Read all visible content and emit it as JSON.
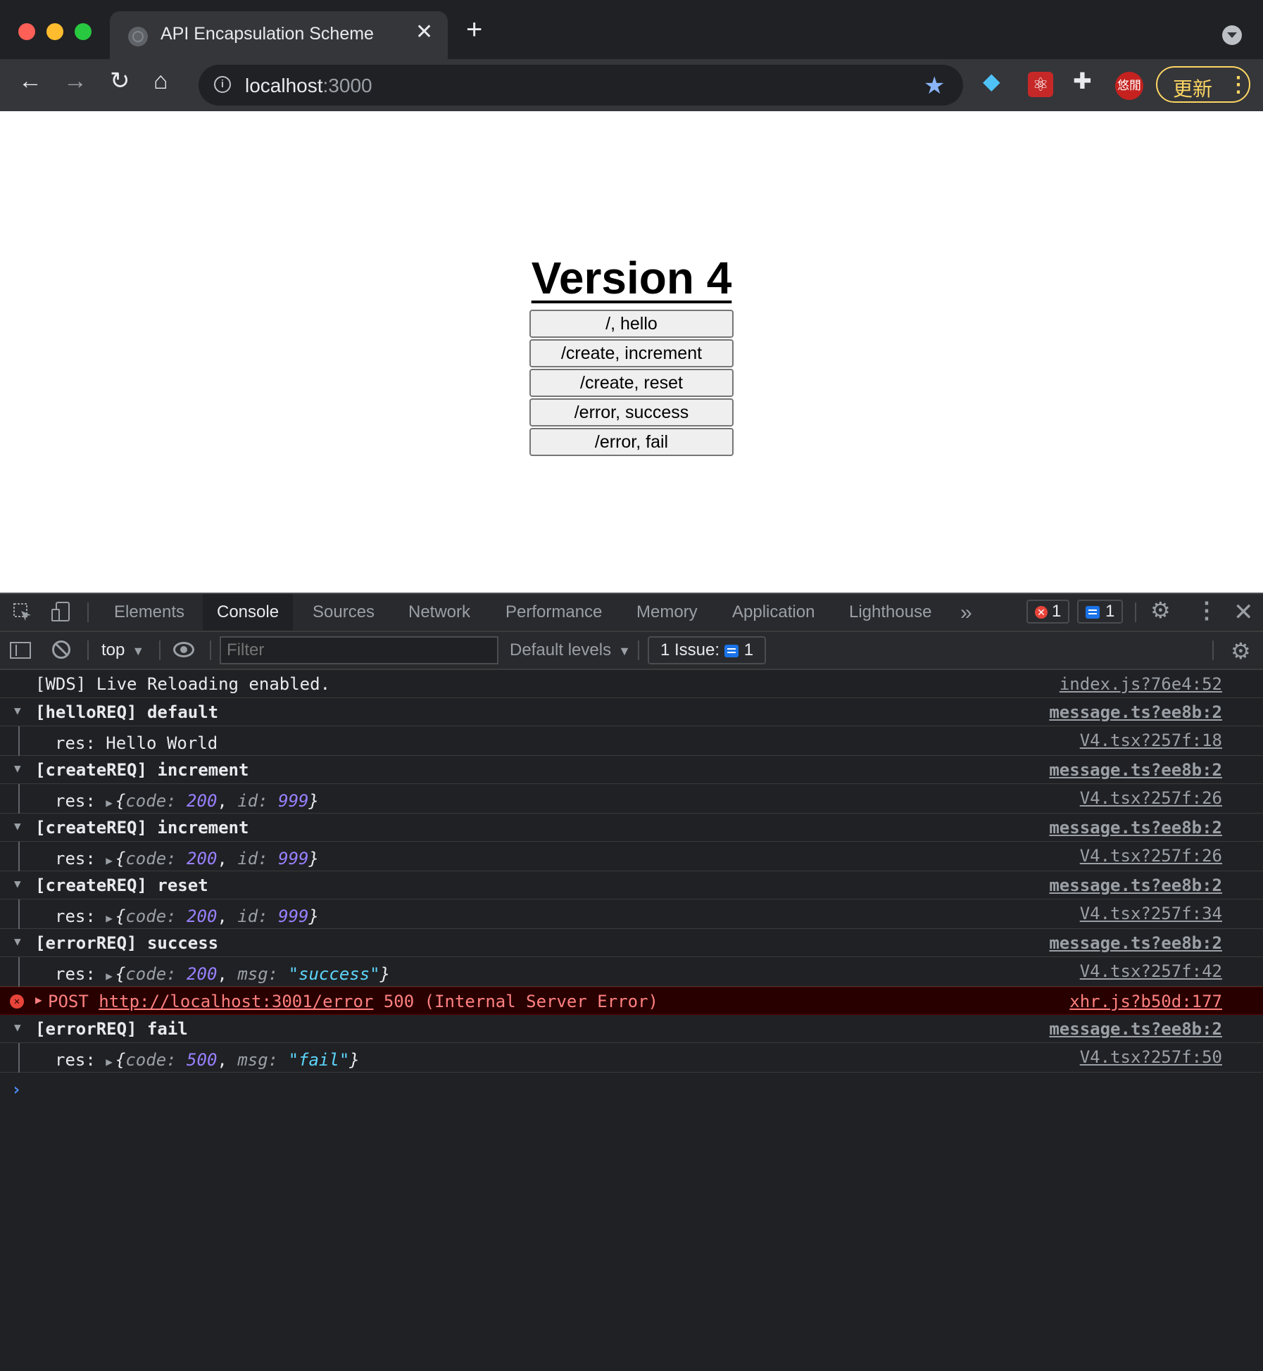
{
  "browser": {
    "tab_title": "API Encapsulation Scheme",
    "tab_close": "✕",
    "new_tab": "+",
    "url_host": "localhost",
    "url_port": ":3000",
    "update_label": "更新",
    "avatar_text": "悠閒"
  },
  "page": {
    "heading": "Version 4",
    "buttons": [
      "/, hello",
      "/create, increment",
      "/create, reset",
      "/error, success",
      "/error, fail"
    ]
  },
  "devtools": {
    "tabs": [
      "Elements",
      "Console",
      "Sources",
      "Network",
      "Performance",
      "Memory",
      "Application",
      "Lighthouse"
    ],
    "active_tab": "Console",
    "error_count": "1",
    "message_count": "1",
    "context": "top",
    "filter_placeholder": "Filter",
    "levels": "Default levels",
    "issues_label": "1 Issue:",
    "issues_count": "1"
  },
  "console": {
    "wds": {
      "text": "[WDS] Live Reloading enabled.",
      "src": "index.js?76e4:52"
    },
    "g1": {
      "text": "[helloREQ] default",
      "src": "message.ts?ee8b:2"
    },
    "r1": {
      "prefix": "res: ",
      "text": "Hello World",
      "src": "V4.tsx?257f:18"
    },
    "g2": {
      "text": "[createREQ] increment",
      "src": "message.ts?ee8b:2"
    },
    "r2": {
      "prefix": "res: ",
      "code": "200",
      "key2": "id",
      "val2": "999",
      "src": "V4.tsx?257f:26"
    },
    "g3": {
      "text": "[createREQ] increment",
      "src": "message.ts?ee8b:2"
    },
    "r3": {
      "prefix": "res: ",
      "code": "200",
      "key2": "id",
      "val2": "999",
      "src": "V4.tsx?257f:26"
    },
    "g4": {
      "text": "[createREQ] reset",
      "src": "message.ts?ee8b:2"
    },
    "r4": {
      "prefix": "res: ",
      "code": "200",
      "key2": "id",
      "val2": "999",
      "src": "V4.tsx?257f:34"
    },
    "g5": {
      "text": "[errorREQ] success",
      "src": "message.ts?ee8b:2"
    },
    "r5": {
      "prefix": "res: ",
      "code": "200",
      "key2": "msg",
      "val2": "\"success\"",
      "src": "V4.tsx?257f:42"
    },
    "err": {
      "method": "POST ",
      "url": "http://localhost:3001/error",
      "status": " 500 (Internal Server Error)",
      "src": "xhr.js?b50d:177"
    },
    "g6": {
      "text": "[errorREQ] fail",
      "src": "message.ts?ee8b:2"
    },
    "r6": {
      "prefix": "res: ",
      "code": "500",
      "key2": "msg",
      "val2": "\"fail\"",
      "src": "V4.tsx?257f:50"
    },
    "prompt": "›"
  }
}
